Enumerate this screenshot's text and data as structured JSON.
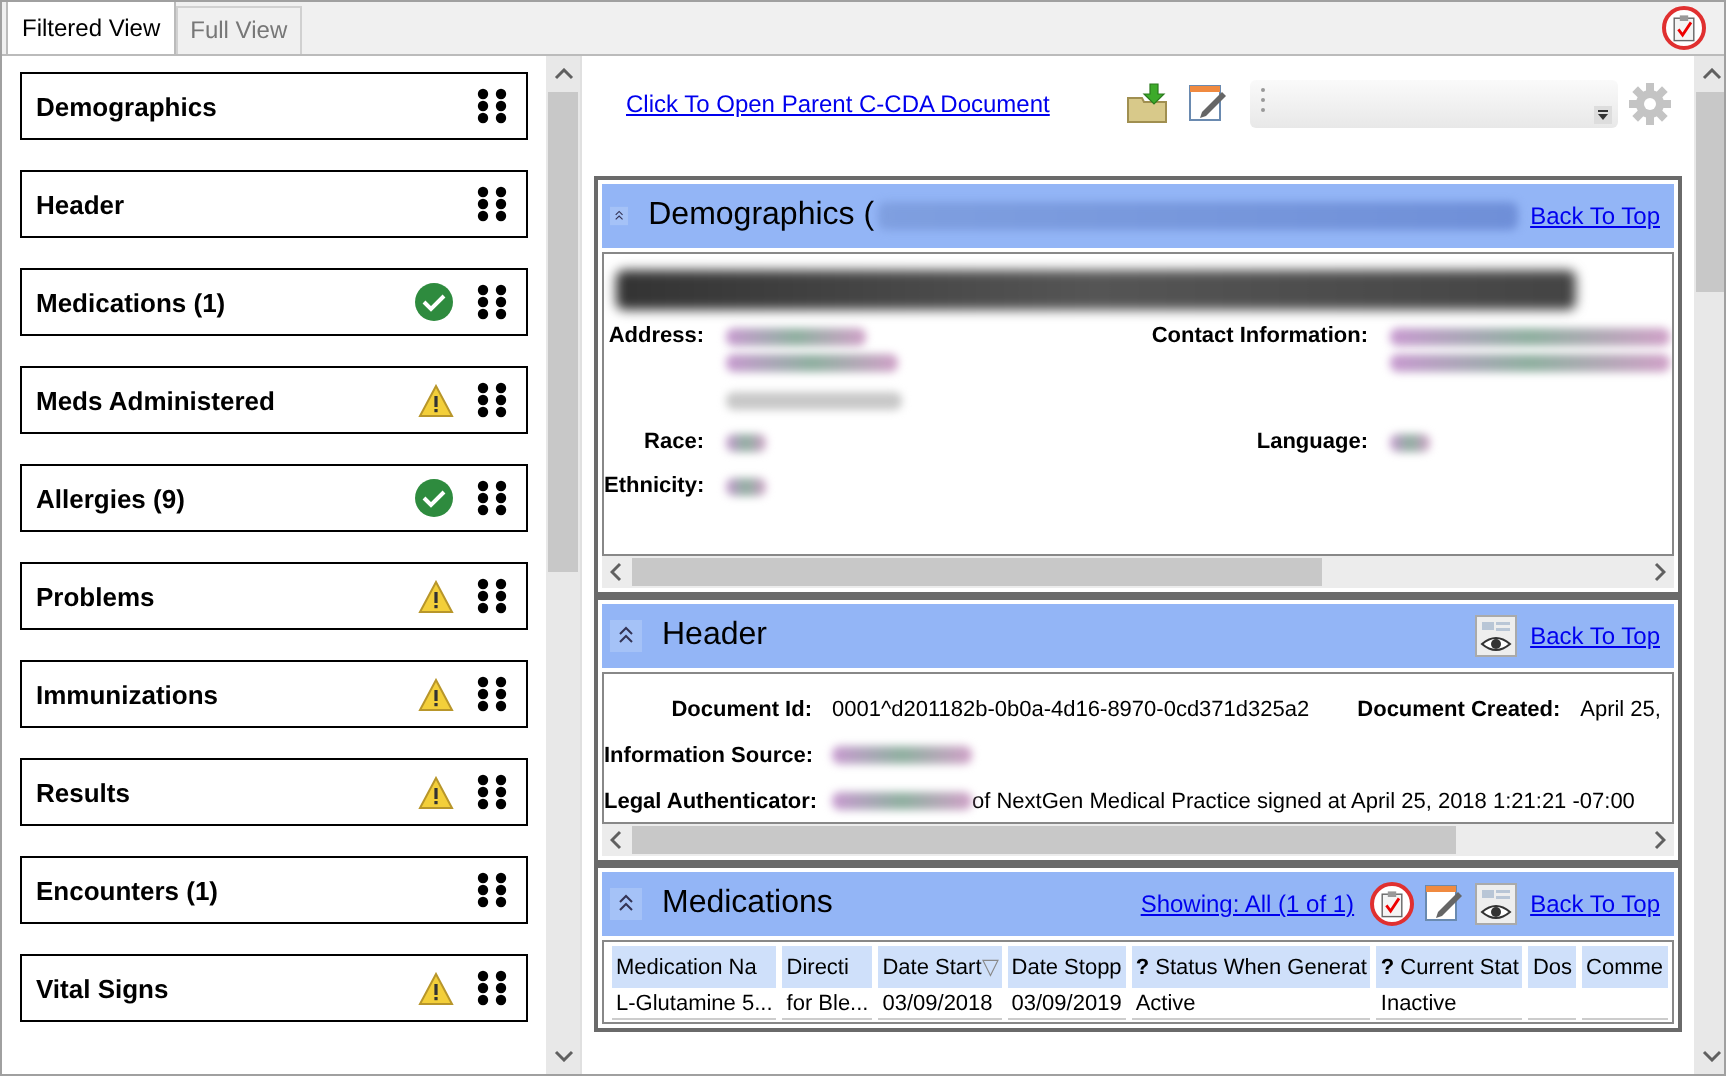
{
  "tabs": [
    {
      "label": "Filtered View",
      "selected": true
    },
    {
      "label": "Full View",
      "selected": false
    }
  ],
  "corner_icon": {
    "highlighted": true
  },
  "sidebar": {
    "items": [
      {
        "label": "Demographics",
        "kind": "plain"
      },
      {
        "label": "Header",
        "kind": "plain"
      },
      {
        "label": "Medications (1)",
        "kind": "ok"
      },
      {
        "label": "Meds Administered",
        "kind": "warning"
      },
      {
        "label": "Allergies (9)",
        "kind": "ok"
      },
      {
        "label": "Problems",
        "kind": "warning"
      },
      {
        "label": "Immunizations",
        "kind": "warning"
      },
      {
        "label": "Results",
        "kind": "warning"
      },
      {
        "label": "Encounters (1)",
        "kind": "plain"
      },
      {
        "label": "Vital Signs",
        "kind": "warning"
      }
    ]
  },
  "parent_link": "Click To Open Parent C-CDA Document",
  "demographics": {
    "title": "Demographics (",
    "title_redacted": true,
    "back_link": "Back To Top",
    "fields": [
      {
        "label": "Address:",
        "kind": "address"
      },
      {
        "label": "Contact Information:",
        "kind": "contact"
      },
      {
        "label": "Race:",
        "kind": "short"
      },
      {
        "label": "Language:",
        "kind": "short"
      },
      {
        "label": "Ethnicity:",
        "kind": "short"
      }
    ]
  },
  "header_section": {
    "title": "Header",
    "back_link": "Back To Top",
    "rows": [
      [
        {
          "label": "Document Id:",
          "value": "0001^d201182b-0b0a-4d16-8970-0cd371d325a2"
        },
        {
          "label": "Document Created:",
          "value": "April 25,"
        }
      ],
      [
        {
          "label": "Information Source:",
          "redacted": true
        }
      ],
      [
        {
          "label": "Legal Authenticator:",
          "value": "of NextGen Medical Practice signed at April 25, 2018 1:21:21 -07:00",
          "redacted": true
        }
      ]
    ]
  },
  "medications": {
    "title": "Medications",
    "showing_link": "Showing: All (1 of 1)",
    "clipboard_highlighted": true,
    "back_link": "Back To Top",
    "columns": [
      {
        "label": "Medication Na"
      },
      {
        "label": "Directi"
      },
      {
        "label": "Date Start",
        "sort_mark": "▽"
      },
      {
        "label": "Date Stopp"
      },
      {
        "label": "Status When Generat",
        "help": "?"
      },
      {
        "label": "Current Stat",
        "help": "?"
      },
      {
        "label": "Dos"
      },
      {
        "label": "Comme"
      }
    ],
    "rows": [
      [
        "L-Glutamine 5...",
        "for Ble...",
        "03/09/2018",
        "03/09/2019",
        "Active",
        "Inactive",
        "",
        ""
      ]
    ]
  }
}
